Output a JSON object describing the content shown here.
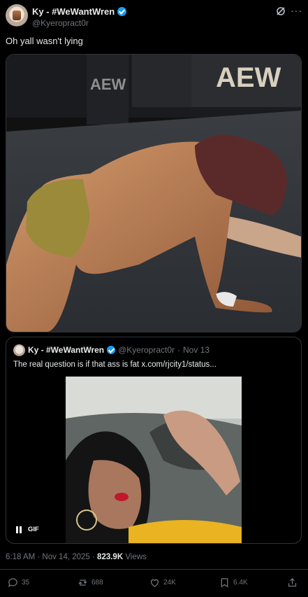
{
  "author": {
    "display_name": "Ky - #WeWantWren",
    "handle": "@Kyeropract0r",
    "verified": true
  },
  "header_icons": [
    "grok-icon",
    "more-icon"
  ],
  "more_label": "···",
  "tweet": {
    "text": "Oh yall wasn't lying",
    "media_watermark": "AEW",
    "timestamp": "6:18 AM · Nov 14, 2025 · ",
    "views_count": "823.9K",
    "views_label": " Views"
  },
  "quote": {
    "display_name": "Ky - #WeWantWren",
    "handle": "@Kyeropract0r",
    "separator": "·",
    "date": "Nov 13",
    "text": "The real question is if that ass is fat  x.com/rjcity1/status...",
    "gif_label": "GIF"
  },
  "actions": {
    "replies": "35",
    "reposts": "688",
    "likes": "24K",
    "bookmarks": "6.4K"
  },
  "colors": {
    "background": "#000000",
    "text": "#e7e9ea",
    "muted": "#71767b",
    "border": "#2f3336",
    "verified": "#1d9bf0"
  }
}
